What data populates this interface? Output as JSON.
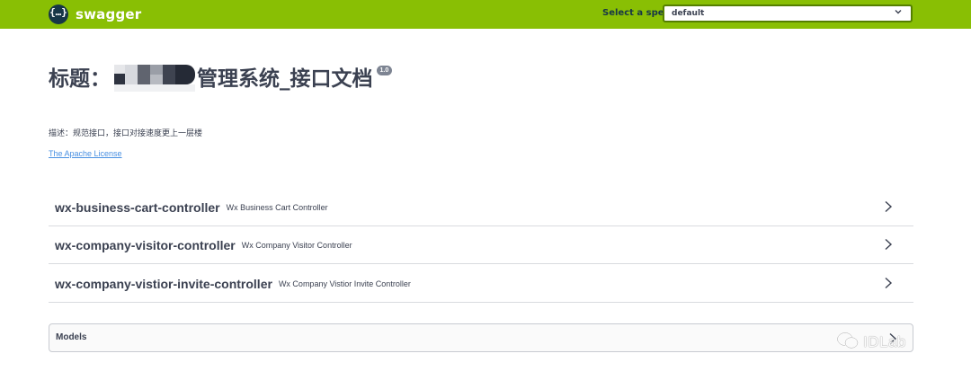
{
  "header": {
    "logo_mark": "{…}",
    "logo_text": "swagger",
    "spec_label": "Select a spec",
    "spec_value": "default"
  },
  "info": {
    "title_prefix": "标题：",
    "title_suffix": "管理系统_接口文档",
    "version": "1.0",
    "description": "描述：规范接口，接口对接速度更上一层楼",
    "license_link": "The Apache License"
  },
  "tags": [
    {
      "name": "wx-business-cart-controller",
      "description": "Wx Business Cart Controller"
    },
    {
      "name": "wx-company-visitor-controller",
      "description": "Wx Company Visitor Controller"
    },
    {
      "name": "wx-company-vistior-invite-controller",
      "description": "Wx Company Vistior Invite Controller"
    }
  ],
  "models": {
    "label": "Models"
  },
  "watermark": {
    "text": "IDLab"
  },
  "colors": {
    "topbar": "#89bf04",
    "text": "#3b4151",
    "link": "#4990e2"
  },
  "icons": {
    "expand": "chevron-right-icon",
    "spec_dropdown": "chevron-down-icon"
  }
}
